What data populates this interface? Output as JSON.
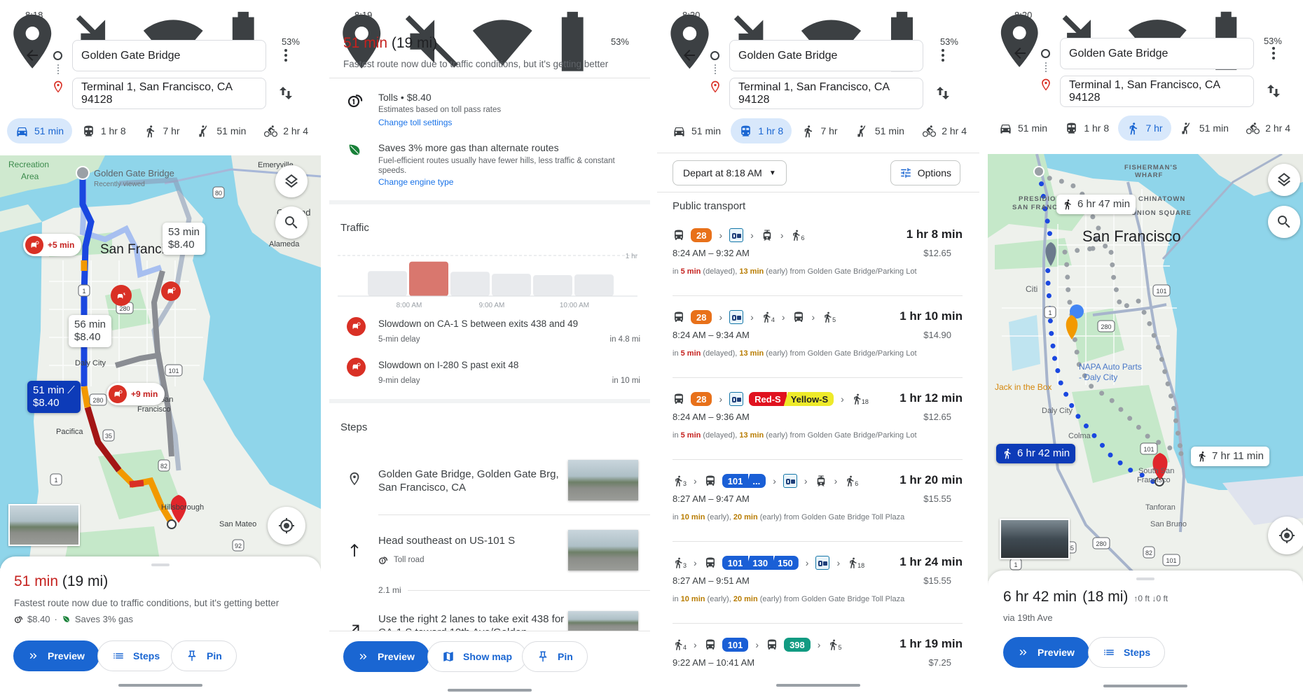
{
  "colors": {
    "accent": "#1a66d2",
    "traffic_red": "#d93025",
    "water": "#8fd5ea",
    "land": "#eef1ec",
    "park": "#c5e8c9",
    "chip_28": "#e8711a",
    "chip_101": "#1a5fd6",
    "chip_398": "#129b82",
    "chip_red_s": "#e0121f",
    "chip_yellow_s": "#eeea2a"
  },
  "common": {
    "battery": "53%",
    "origin": "Golden Gate Bridge",
    "destination": "Terminal 1, San Francisco, CA 94128",
    "tabs": [
      {
        "mode": "car-icon",
        "label": "51 min"
      },
      {
        "mode": "transit-icon",
        "label": "1 hr 8"
      },
      {
        "mode": "walk-icon",
        "label": "7 hr"
      },
      {
        "mode": "ride-hail-icon",
        "label": "51 min"
      },
      {
        "mode": "bike-icon",
        "label": "2 hr 4"
      }
    ]
  },
  "panel1": {
    "time": "8:18",
    "active_tab": 0,
    "map": {
      "labels": {
        "recreation": "Recreation",
        "area": "Area",
        "ggb": "Golden Gate Bridge",
        "recent": "Recently viewed",
        "emeryville": "Emeryville",
        "oakland": "Oakland",
        "alameda": "Alameda",
        "sf": "San Francisco",
        "daly": "Daly City",
        "ssf1": "South San",
        "ssf2": "Francisco",
        "pacifica": "Pacifica",
        "hillsborough": "Hillsborough",
        "sanmateo": "San Mateo"
      },
      "shields": [
        "80",
        "1",
        "280",
        "101",
        "280",
        "35",
        "82",
        "92",
        "1"
      ],
      "delays": [
        "+5 min",
        "+9 min"
      ],
      "alt_routes": [
        {
          "time": "53 min",
          "toll": "$8.40"
        },
        {
          "time": "56 min",
          "toll": "$8.40"
        }
      ],
      "selected_route": {
        "time": "51 min",
        "toll": "$8.40"
      }
    },
    "sheet": {
      "duration": "51 min",
      "distance": "(19 mi)",
      "subtitle": "Fastest route now due to traffic conditions, but it's getting better",
      "toll": "$8.40",
      "sep": "·",
      "gas": "Saves 3% gas"
    },
    "buttons": {
      "preview": "Preview",
      "steps": "Steps",
      "pin": "Pin"
    }
  },
  "panel2": {
    "time": "8:19",
    "duration": "51 min",
    "distance": "(19 mi)",
    "subtitle": "Fastest route now due to traffic conditions, but it's getting better",
    "tolls": {
      "title": "Tolls • $8.40",
      "note": "Estimates based on toll pass rates",
      "link": "Change toll settings"
    },
    "gas": {
      "title": "Saves 3% more gas than alternate routes",
      "note": "Fuel-efficient routes usually have fewer hills, less traffic & constant speeds.",
      "link": "Change engine type"
    },
    "traffic_title": "Traffic",
    "chart_data": {
      "type": "bar",
      "ylabel": "",
      "ref_line_label": "1 hr",
      "ref_line_value": 60,
      "values": [
        37,
        51,
        36,
        33,
        31,
        32
      ],
      "highlight_index": 1,
      "tick_labels": [
        "8:00 AM",
        "9:00 AM",
        "10:00 AM"
      ],
      "ylim": [
        0,
        60
      ],
      "grid": false
    },
    "slowdowns": [
      {
        "title": "Slowdown on CA-1 S between exits 438 and 49",
        "delay": "5-min delay",
        "dist": "in 4.8 mi"
      },
      {
        "title": "Slowdown on I-280 S past exit 48",
        "delay": "9-min delay",
        "dist": "in 10 mi"
      }
    ],
    "steps_title": "Steps",
    "steps": [
      {
        "title": "Golden Gate Bridge, Golden Gate Brg, San Francisco, CA"
      },
      {
        "title": "Head southeast on US-101 S",
        "note": "Toll road"
      },
      {
        "title": "Use the right 2 lanes to take exit 438 for CA-1 S toward 19th Ave/Golden"
      }
    ],
    "step_distance": "2.1 mi",
    "buttons": {
      "preview": "Preview",
      "show_map": "Show map",
      "pin": "Pin"
    }
  },
  "panel3": {
    "time": "8:20",
    "active_tab": 1,
    "depart": "Depart at 8:18 AM",
    "options": "Options",
    "section": "Public transport",
    "routes": [
      {
        "legs": [
          {
            "t": "bus"
          },
          {
            "t": "chip",
            "labels": [
              "28"
            ],
            "color": "#e8711a"
          },
          {
            "t": ">"
          },
          {
            "t": "bart"
          },
          {
            "t": ">"
          },
          {
            "t": "tram"
          },
          {
            "t": ">"
          },
          {
            "t": "walk",
            "n": "6"
          }
        ],
        "duration": "1 hr 8 min",
        "times": "8:24 AM – 9:32 AM",
        "price": "$12.65",
        "info": [
          {
            "s": "in ",
            "c": ""
          },
          {
            "s": "5 min",
            "c": "delayed"
          },
          {
            "s": " (delayed), ",
            "c": ""
          },
          {
            "s": "13 min",
            "c": "early"
          },
          {
            "s": " (early) from Golden Gate Bridge/Parking Lot",
            "c": ""
          }
        ]
      },
      {
        "legs": [
          {
            "t": "bus"
          },
          {
            "t": "chip",
            "labels": [
              "28"
            ],
            "color": "#e8711a"
          },
          {
            "t": ">"
          },
          {
            "t": "bart"
          },
          {
            "t": ">"
          },
          {
            "t": "walk",
            "n": "4"
          },
          {
            "t": ">"
          },
          {
            "t": "bus"
          },
          {
            "t": ">"
          },
          {
            "t": "walk",
            "n": "5"
          }
        ],
        "duration": "1 hr 10 min",
        "times": "8:24 AM – 9:34 AM",
        "price": "$14.90",
        "info": [
          {
            "s": "in ",
            "c": ""
          },
          {
            "s": "5 min",
            "c": "delayed"
          },
          {
            "s": " (delayed), ",
            "c": ""
          },
          {
            "s": "13 min",
            "c": "early"
          },
          {
            "s": " (early) from Golden Gate Bridge/Parking Lot",
            "c": ""
          }
        ]
      },
      {
        "legs": [
          {
            "t": "bus"
          },
          {
            "t": "chip",
            "labels": [
              "28"
            ],
            "color": "#e8711a"
          },
          {
            "t": ">"
          },
          {
            "t": "bart"
          },
          {
            "t": "chip",
            "labels": [
              "Red-S",
              "Yellow-S"
            ],
            "colors": [
              "#e0121f",
              "#eeea2a"
            ]
          },
          {
            "t": ">"
          },
          {
            "t": "walk",
            "n": "18"
          }
        ],
        "duration": "1 hr 12 min",
        "times": "8:24 AM – 9:36 AM",
        "price": "$12.65",
        "info": [
          {
            "s": "in ",
            "c": ""
          },
          {
            "s": "5 min",
            "c": "delayed"
          },
          {
            "s": " (delayed), ",
            "c": ""
          },
          {
            "s": "13 min",
            "c": "early"
          },
          {
            "s": " (early) from Golden Gate Bridge/Parking Lot",
            "c": ""
          }
        ]
      },
      {
        "legs": [
          {
            "t": "walk",
            "n": "3"
          },
          {
            "t": ">"
          },
          {
            "t": "bus"
          },
          {
            "t": "chip",
            "labels": [
              "101",
              "..."
            ],
            "color": "#1a5fd6"
          },
          {
            "t": ">"
          },
          {
            "t": "bart"
          },
          {
            "t": ">"
          },
          {
            "t": "tram"
          },
          {
            "t": ">"
          },
          {
            "t": "walk",
            "n": "6"
          }
        ],
        "duration": "1 hr 20 min",
        "times": "8:27 AM – 9:47 AM",
        "price": "$15.55",
        "info": [
          {
            "s": "in ",
            "c": ""
          },
          {
            "s": "10 min",
            "c": "early"
          },
          {
            "s": " (early), ",
            "c": ""
          },
          {
            "s": "20 min",
            "c": "early"
          },
          {
            "s": " (early) from Golden Gate Bridge Toll Plaza",
            "c": ""
          }
        ]
      },
      {
        "legs": [
          {
            "t": "walk",
            "n": "3"
          },
          {
            "t": ">"
          },
          {
            "t": "bus"
          },
          {
            "t": "chip",
            "labels": [
              "101",
              "130",
              "150"
            ],
            "color": "#1a5fd6"
          },
          {
            "t": ">"
          },
          {
            "t": "bart"
          },
          {
            "t": ">"
          },
          {
            "t": "walk",
            "n": "18"
          }
        ],
        "duration": "1 hr 24 min",
        "times": "8:27 AM – 9:51 AM",
        "price": "$15.55",
        "info": [
          {
            "s": "in ",
            "c": ""
          },
          {
            "s": "10 min",
            "c": "early"
          },
          {
            "s": " (early), ",
            "c": ""
          },
          {
            "s": "20 min",
            "c": "early"
          },
          {
            "s": " (early) from Golden Gate Bridge Toll Plaza",
            "c": ""
          }
        ]
      },
      {
        "legs": [
          {
            "t": "walk",
            "n": "4"
          },
          {
            "t": ">"
          },
          {
            "t": "bus"
          },
          {
            "t": "chip",
            "labels": [
              "101"
            ],
            "color": "#1a5fd6"
          },
          {
            "t": ">"
          },
          {
            "t": "bus"
          },
          {
            "t": "chip",
            "labels": [
              "398"
            ],
            "color": "#129b82"
          },
          {
            "t": ">"
          },
          {
            "t": "walk",
            "n": "5"
          }
        ],
        "duration": "1 hr 19 min",
        "times": "9:22 AM – 10:41 AM",
        "price": "$7.25",
        "info": []
      }
    ]
  },
  "panel4": {
    "time": "8:20",
    "active_tab": 2,
    "map": {
      "labels": {
        "fw1": "FISHERMAN'S",
        "fw2": "WHARF",
        "presidio1": "PRESIDIO OF",
        "presidio2": "SAN FRANCISCO",
        "chinatown": "CHINATOWN",
        "union": "UNION SQUARE",
        "sf": "San Francisco",
        "citi": "Citi",
        "napa1": "NAPA Auto Parts",
        "napa2": "- Daly City",
        "jack": "Jack in the Box",
        "daly": "Daly City",
        "colma": "Colma",
        "ssf1": "South San",
        "ssf2": "Francisco",
        "tanforan": "Tanforan",
        "sanbruno": "San Bruno"
      },
      "shields": [
        "1",
        "101",
        "280",
        "101",
        "35",
        "280",
        "82",
        "101",
        "1"
      ],
      "alt_routes": [
        "6 hr 47 min",
        "7 hr 11 min"
      ],
      "selected_route": "6 hr 42 min"
    },
    "sheet": {
      "duration": "6 hr 42 min",
      "distance": "(18 mi)",
      "ascent": "0 ft",
      "descent": "0 ft",
      "via": "via 19th Ave"
    },
    "buttons": {
      "preview": "Preview",
      "steps": "Steps"
    }
  }
}
